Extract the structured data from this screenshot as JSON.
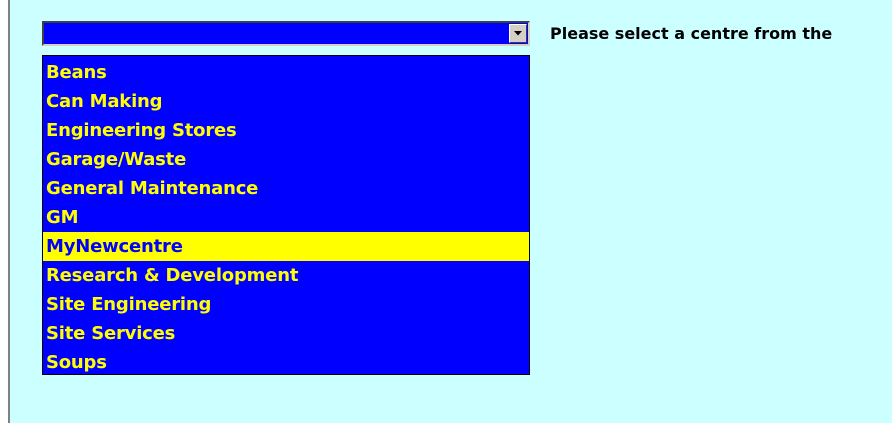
{
  "combo": {
    "selected_value": "",
    "button_icon": "chevron-down-icon"
  },
  "prompt": {
    "text": "Please select a centre from the"
  },
  "dropdown": {
    "options": [
      "Beans",
      "Can Making",
      "Engineering Stores",
      "Garage/Waste",
      "General Maintenance",
      "GM",
      "MyNewcentre",
      "Research & Development",
      "Site Engineering",
      "Site Services",
      "Soups"
    ],
    "highlighted": "MyNewcentre"
  },
  "colors": {
    "panel_background": "#ccffff",
    "list_background": "#0000ff",
    "list_text": "#ffff00",
    "highlight_background": "#ffff00",
    "highlight_text": "#0000ff"
  }
}
